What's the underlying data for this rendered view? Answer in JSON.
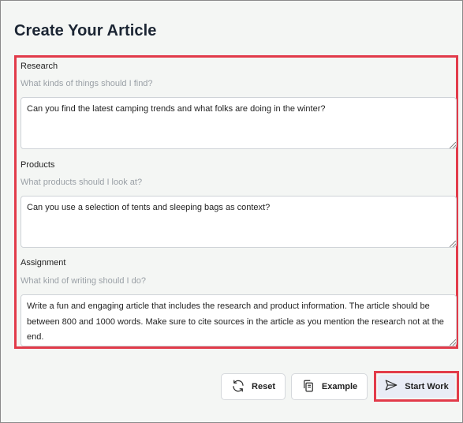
{
  "page": {
    "title": "Create Your Article"
  },
  "form": {
    "research": {
      "label": "Research",
      "hint": "What kinds of things should I find?",
      "value": "Can you find the latest camping trends and what folks are doing in the winter?"
    },
    "products": {
      "label": "Products",
      "hint": "What products should I look at?",
      "value": "Can you use a selection of tents and sleeping bags as context?"
    },
    "assignment": {
      "label": "Assignment",
      "hint": "What kind of writing should I do?",
      "value": "Write a fun and engaging article that includes the research and product information. The article should be between 800 and 1000 words. Make sure to cite sources in the article as you mention the research not at the end."
    }
  },
  "actions": {
    "reset_label": "Reset",
    "example_label": "Example",
    "start_label": "Start Work"
  },
  "colors": {
    "highlight": "#e23b4a",
    "primary_button_bg": "#e9ecf6"
  },
  "icons": {
    "reset": "refresh-icon",
    "example": "copy-icon",
    "start": "send-icon"
  }
}
